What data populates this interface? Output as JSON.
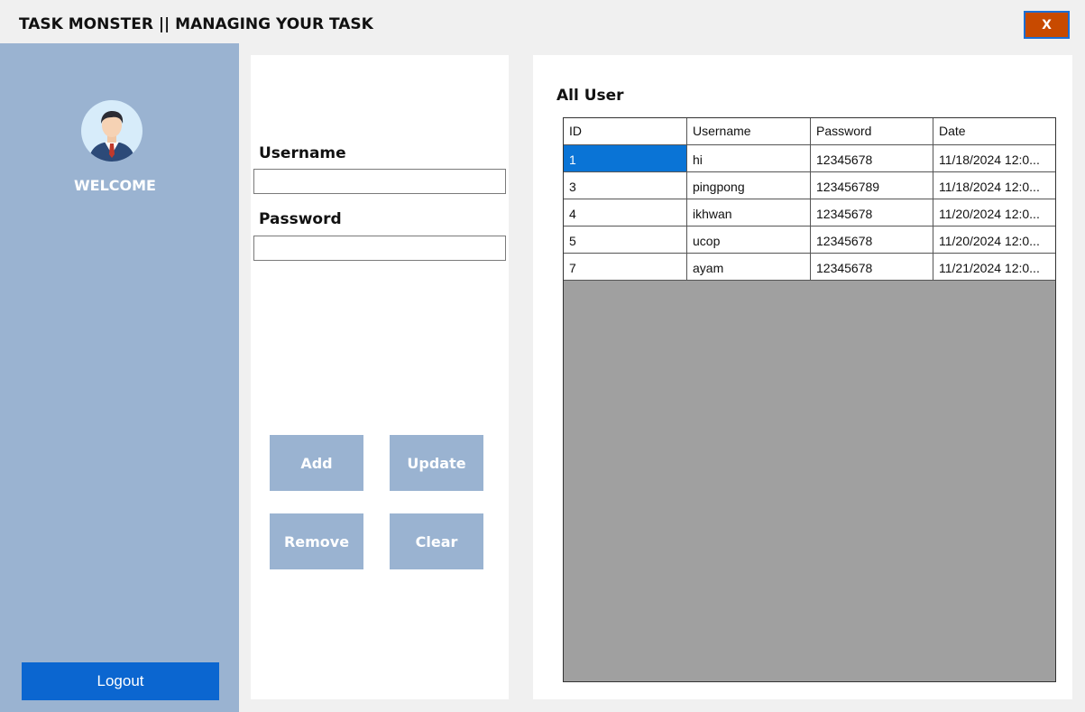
{
  "window": {
    "title": "TASK MONSTER || MANAGING YOUR TASK",
    "close_label": "X",
    "close_color": "#c84a00"
  },
  "sidebar": {
    "background": "#9ab3d1",
    "avatar_icon": "user-avatar-icon",
    "welcome": "WELCOME",
    "logout_label": "Logout",
    "logout_color": "#0b66d0"
  },
  "form": {
    "username_label": "Username",
    "username_value": "",
    "password_label": "Password",
    "password_value": "",
    "buttons": {
      "add": "Add",
      "update": "Update",
      "remove": "Remove",
      "clear": "Clear"
    }
  },
  "table": {
    "title": "All User",
    "columns": [
      "ID",
      "Username",
      "Password",
      "Date"
    ],
    "rows": [
      [
        "1",
        "hi",
        "12345678",
        "11/18/2024 12:0..."
      ],
      [
        "3",
        "pingpong",
        "123456789",
        "11/18/2024 12:0..."
      ],
      [
        "4",
        "ikhwan",
        "12345678",
        "11/20/2024 12:0..."
      ],
      [
        "5",
        "ucop",
        "12345678",
        "11/20/2024 12:0..."
      ],
      [
        "7",
        "ayam",
        "12345678",
        "11/21/2024 12:0..."
      ]
    ],
    "selected_color": "#0a74d6"
  }
}
